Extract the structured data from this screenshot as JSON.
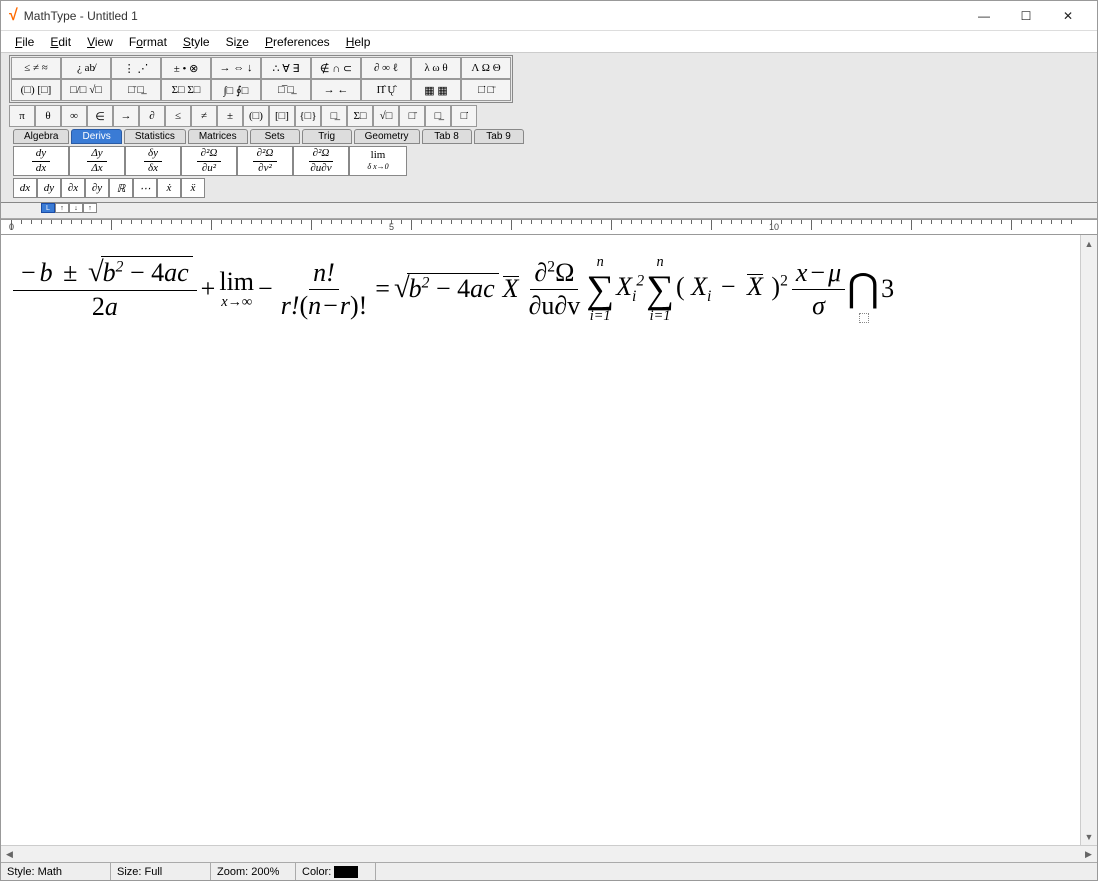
{
  "app": {
    "name": "MathType",
    "doc": "Untitled 1",
    "title": "MathType - Untitled 1"
  },
  "window_controls": {
    "min": "—",
    "max": "☐",
    "close": "✕"
  },
  "menu": [
    "File",
    "Edit",
    "View",
    "Format",
    "Style",
    "Size",
    "Preferences",
    "Help"
  ],
  "palette_row1": [
    "≤ ≠ ≈",
    "¿ ab̸",
    "⋮ ⋰",
    "± • ⊗",
    "→ ⇔ ↓",
    "∴ ∀ ∃",
    "∉ ∩ ⊂",
    "∂ ∞ ℓ",
    "λ ω θ",
    "Λ Ω Θ"
  ],
  "palette_row2": [
    "(□) [□]",
    "□/□ √□",
    "□̄ □̲",
    "Σ□ Σ□",
    "∫□ ∮□",
    "□̅ □̲",
    "→ ←",
    "Π̂ Ų̂",
    "▦ ▦",
    "□̇ □̈"
  ],
  "symbol_row": [
    "π",
    "θ",
    "∞",
    "∈",
    "→",
    "∂",
    "≤",
    "≠",
    "±",
    "(□)",
    "[□]",
    "{□}",
    "□̲",
    "Σ□",
    "√□",
    "□̄",
    "□̲",
    "□̇"
  ],
  "tabs": [
    "Algebra",
    "Derivs",
    "Statistics",
    "Matrices",
    "Sets",
    "Trig",
    "Geometry",
    "Tab 8",
    "Tab 9"
  ],
  "active_tab": 1,
  "deriv_buttons": [
    "dy/dx",
    "Δy/Δx",
    "δy/δx",
    "∂²Ω/∂u²",
    "∂²Ω/∂v²",
    "∂²Ω/∂u∂v",
    "lim δx→0"
  ],
  "small_row": [
    "dx",
    "dy",
    "∂x",
    "∂y",
    "ℝ",
    "⋯",
    "ẋ",
    "ẍ"
  ],
  "ruler": {
    "marks": [
      0,
      5,
      10
    ]
  },
  "equation": {
    "quad": {
      "num_pre": "−",
      "b": "b",
      "pm": "±",
      "sqrt": "b",
      "sup": "2",
      "minus": "− 4",
      "a": "a",
      "c": "c",
      "den_two": "2",
      "den_a": "a"
    },
    "plus": "+",
    "lim": {
      "word": "lim",
      "below": "x→∞"
    },
    "minus": "−",
    "nfrac": {
      "num": "n!",
      "den_pre": "r!",
      "den_open": "(",
      "den_n": "n",
      "den_minus": "−",
      "den_r": "r",
      "den_close": ")",
      "den_excl": "!"
    },
    "eq": "=",
    "sqrt2": {
      "b": "b",
      "sup": "2",
      "minus": "− 4",
      "a": "a",
      "c": "c"
    },
    "xbar": "X",
    "pd": {
      "num_d": "∂",
      "num_sup": "2",
      "num_omega": "Ω",
      "den_du": "∂u",
      "den_dv": "∂v"
    },
    "sum1": {
      "top": "n",
      "bot": "i=1",
      "sym": "∑",
      "term_X": "X",
      "term_sub": "i",
      "term_sup": "2"
    },
    "sum2": {
      "top": "n",
      "bot": "i=1",
      "sym": "∑",
      "open": "(",
      "Xi": "X",
      "Xi_sub": "i",
      "minus": "−",
      "Xbar": "X",
      "close": ")",
      "sup": "2"
    },
    "zfrac": {
      "num_x": "x",
      "num_minus": "−",
      "num_mu": "μ",
      "den_sigma": "σ"
    },
    "bigcap": "⋂",
    "three": "3"
  },
  "status": {
    "style_label": "Style:",
    "style": "Math",
    "size_label": "Size:",
    "size": "Full",
    "zoom_label": "Zoom:",
    "zoom": "200%",
    "color_label": "Color:"
  }
}
